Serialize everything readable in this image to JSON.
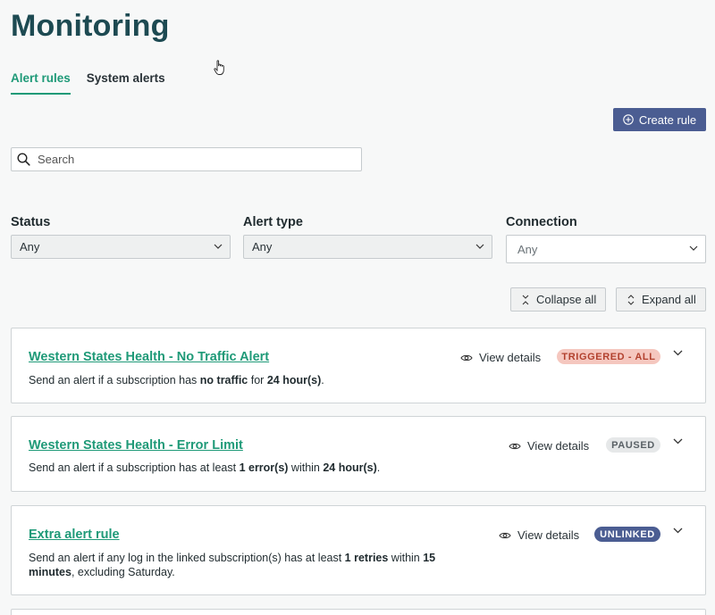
{
  "page": {
    "title": "Monitoring"
  },
  "tabs": [
    {
      "label": "Alert rules",
      "active": true
    },
    {
      "label": "System alerts",
      "active": false
    }
  ],
  "toolbar": {
    "create_label": "Create rule"
  },
  "search": {
    "placeholder": "Search"
  },
  "filters": {
    "status": {
      "label": "Status",
      "value": "Any"
    },
    "alert_type": {
      "label": "Alert type",
      "value": "Any"
    },
    "connection": {
      "label": "Connection",
      "value": "Any"
    }
  },
  "actions": {
    "collapse_label": "Collapse all",
    "expand_label": "Expand all"
  },
  "view_details_label": "View details",
  "rules": [
    {
      "title": "Western States Health - No Traffic Alert",
      "badge": "TRIGGERED - ALL",
      "desc": {
        "t1": "Send an alert if a subscription has ",
        "b1": "no traffic",
        "t2": " for ",
        "b2": "24 hour(s)",
        "t3": "."
      }
    },
    {
      "title": "Western States Health - Error Limit",
      "badge": "PAUSED",
      "desc": {
        "t1": "Send an alert if a subscription has at least ",
        "b1": "1 error(s)",
        "t2": " within ",
        "b2": "24 hour(s)",
        "t3": "."
      }
    },
    {
      "title": "Extra alert rule",
      "badge": "UNLINKED",
      "desc": {
        "t1": "Send an alert if any log in the linked subscription(s) has at least ",
        "b1": "1 retries",
        "t2": " within ",
        "b2": "15 minutes",
        "t3": ", excluding Saturday."
      }
    }
  ],
  "colors": {
    "accent": "#1f9a78",
    "primary_button": "#4b5d92",
    "title": "#1d4a52",
    "triggered_badge_bg": "#f5c7bf",
    "triggered_badge_text": "#b2412e",
    "paused_badge_bg": "#e6e8e9",
    "unlinked_badge_bg": "#4b5d92"
  }
}
